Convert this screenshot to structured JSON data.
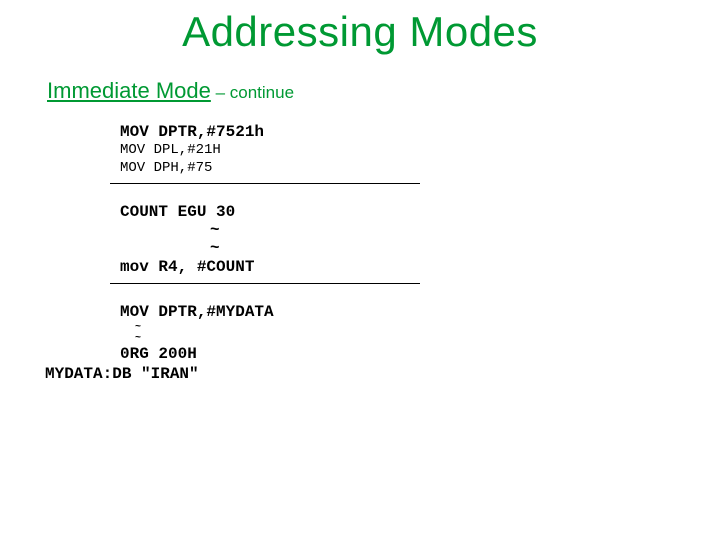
{
  "title": "Addressing Modes",
  "subtitle": {
    "mode": "Immediate Mode",
    "cont": " – continue"
  },
  "block1": {
    "line1": "MOV DPTR,#7521h",
    "line2": "MOV DPL,#21H",
    "line3": "MOV DPH,#75"
  },
  "block2": {
    "line1": "COUNT EGU 30",
    "tilde": "~",
    "line2": "mov R4, #COUNT"
  },
  "block3": {
    "line1": "MOV DPTR,#MYDATA",
    "tilde": "~",
    "line2": "0RG 200H",
    "line3": "MYDATA:DB \"IRAN\""
  }
}
